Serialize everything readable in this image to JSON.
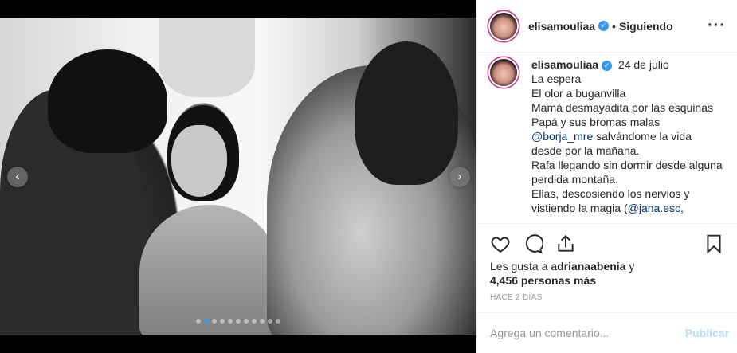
{
  "post": {
    "username": "elisamouliaa",
    "follow_status": "Siguiendo",
    "separator": "•",
    "more_icon": "···",
    "verified_mark": "✓"
  },
  "caption": {
    "username": "elisamouliaa",
    "date": "24 de julio",
    "lines": [
      "La espera",
      "El olor a buganvilla",
      "Mamá desmayadita por las esquinas",
      "Papá y sus bromas malas",
      "salvándome la vida desde por la mañana.",
      "Rafa llegando sin dormir desde alguna perdida montaña.",
      "Ellas, descosiendo los nervios y vistiendo la magia ("
    ],
    "mention_1": "@borja_mre",
    "mention_2": "@jana.esc",
    "trail": ","
  },
  "carousel": {
    "prev_icon": "‹",
    "next_icon": "›",
    "dot_count": 11,
    "active_dot": 1
  },
  "likes": {
    "prefix": "Les gusta a",
    "first_liker": "adrianaabenia",
    "joiner": "y",
    "others": "4,456 personas más"
  },
  "time_ago": "HACE 2 DÍAS",
  "comment": {
    "placeholder": "Agrega un comentario...",
    "publish_label": "Publicar"
  },
  "icons": {
    "like": "heart-icon",
    "comment": "comment-icon",
    "share": "share-icon",
    "save": "bookmark-icon"
  },
  "colors": {
    "accent": "#3897f0",
    "publish_disabled": "#b2dffc",
    "mention": "#003569"
  }
}
